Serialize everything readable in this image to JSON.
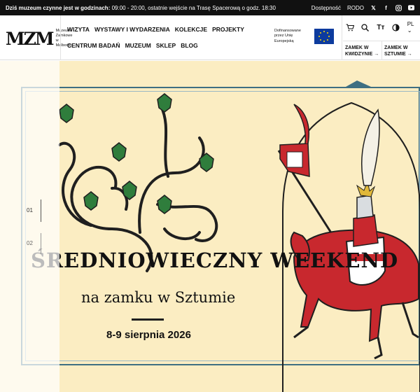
{
  "topbar": {
    "message_bold": "Dziś muzeum czynne jest w godzinach:",
    "message_rest": " 09:00 - 20:00, ostatnie wejście na Trasę Spacerową o godz. 18:30",
    "accessibility": "Dostępność",
    "rodo": "RODO",
    "social": [
      "X",
      "f",
      "instagram",
      "youtube"
    ]
  },
  "header": {
    "logo_mark": "MZM",
    "logo_text": "Muzeum Zamkowe w Malborku",
    "nav_row1": [
      "WIZYTA",
      "WYSTAWY I WYDARZENIA",
      "KOLEKCJE",
      "PROJEKTY"
    ],
    "nav_row2": [
      "CENTRUM BADAŃ",
      "MUZEUM",
      "SKLEP",
      "BLOG"
    ],
    "eu_text": "Dofinansowane przez Unię Europejską",
    "language": "PL",
    "castle_kwidzyn": "ZAMEK W KWIDZYNIE →",
    "castle_sztum": "ZAMEK W SZTUMIE →"
  },
  "hero": {
    "slide1": "01",
    "slide2": "02",
    "title_line1": "ŚREDNIOWIECZNY WEEKEND",
    "title_line2": "na zamku w Sztumie",
    "date": "8-9 sierpnia 2026"
  },
  "colors": {
    "background": "#fbedc2",
    "frame": "#3e6f82",
    "vine": "#1f1f1f",
    "leaf": "#2f7d3c",
    "knight_red": "#c8282e"
  }
}
